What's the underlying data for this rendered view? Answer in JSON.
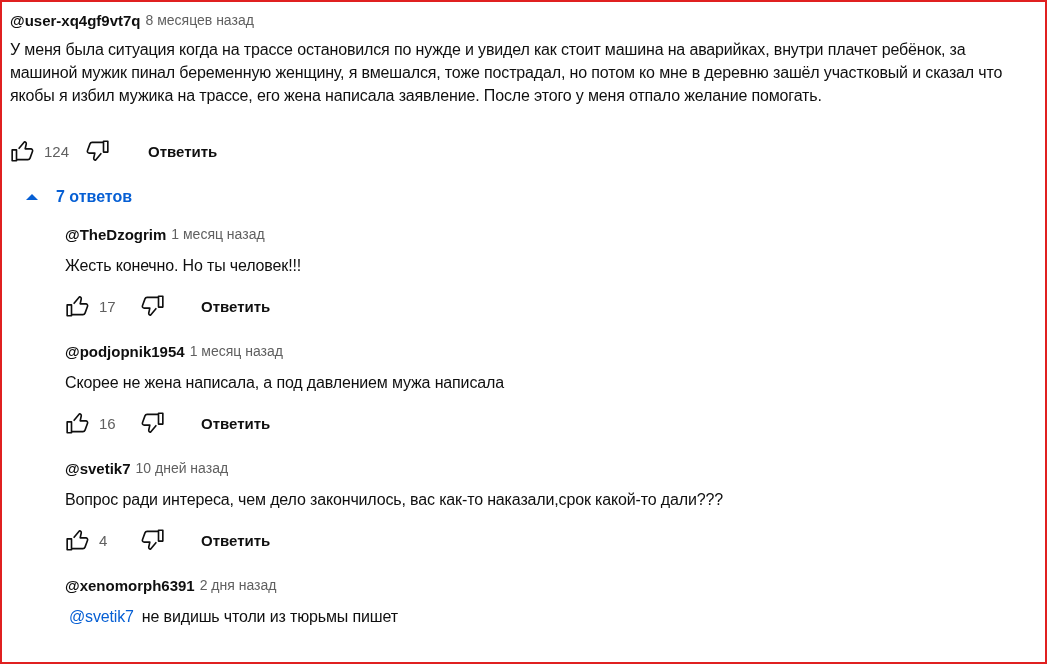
{
  "comment": {
    "author": "@user-xq4gf9vt7q",
    "time": "8 месяцев назад",
    "text": "У меня была ситуация когда на трассе остановился по нужде и увидел как стоит машина на аварийках, внутри плачет ребёнок, за машиной мужик пинал беременную женщину, я вмешался, тоже пострадал, но потом ко мне в деревню зашёл участковый и сказал что якобы я избил мужика на трассе, его жена написала заявление. После этого у меня отпало желание помогать.",
    "likes": "124",
    "reply_button": "Ответить"
  },
  "replies_toggle": {
    "label": "7 ответов",
    "expanded": true
  },
  "replies": [
    {
      "author": "@TheDzogrim",
      "time": "1 месяц назад",
      "text": "Жесть конечно. Но ты человек!!!",
      "likes": "17",
      "reply_button": "Ответить"
    },
    {
      "author": "@podjopnik1954",
      "time": "1 месяц назад",
      "text": "Скорее не жена написала, а под давлением мужа написала",
      "likes": "16",
      "reply_button": "Ответить"
    },
    {
      "author": "@svetik7",
      "time": "10 дней назад",
      "text": "Вопрос ради интереса, чем дело закончилось, вас как-то наказали,срок какой-то дали???",
      "likes": "4",
      "reply_button": "Ответить"
    },
    {
      "author": "@xenomorph6391",
      "time": "2 дня назад",
      "mention": "@svetik7",
      "text": "не видишь чтоли из тюрьмы пишет"
    }
  ]
}
